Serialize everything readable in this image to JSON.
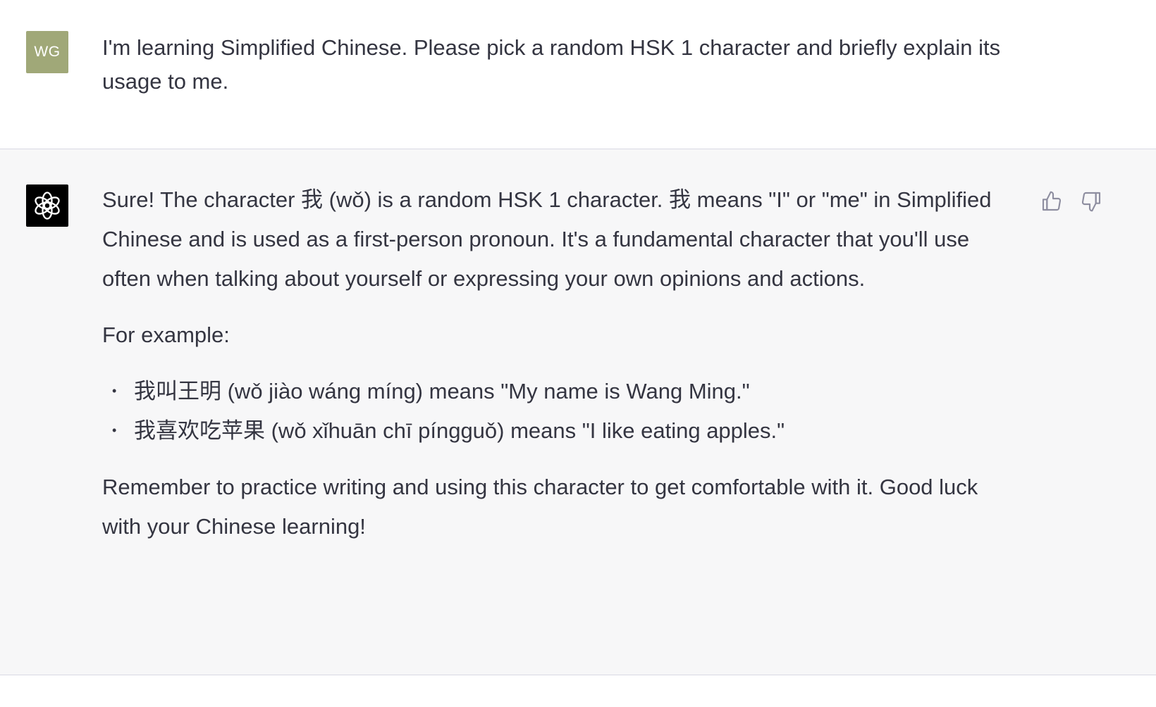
{
  "conversation": {
    "user": {
      "avatar_initials": "WG",
      "avatar_color": "#a0a878",
      "message": "I'm learning Simplified Chinese. Please pick a random HSK 1 character and briefly explain its usage to me."
    },
    "assistant": {
      "avatar_icon": "openai-logo-icon",
      "intro": "Sure! The character 我 (wǒ) is a random HSK 1 character. 我 means \"I\" or \"me\" in Simplified Chinese and is used as a first-person pronoun. It's a fundamental character that you'll use often when talking about yourself or expressing your own opinions and actions.",
      "example_heading": "For example:",
      "examples": [
        "我叫王明 (wǒ jiào wáng míng) means \"My name is Wang Ming.\"",
        "我喜欢吃苹果 (wǒ xǐhuān chī píngguǒ) means \"I like eating apples.\""
      ],
      "closing": "Remember to practice writing and using this character to get comfortable with it. Good luck with your Chinese learning!",
      "feedback": {
        "thumbs_up_icon": "thumbs-up-icon",
        "thumbs_down_icon": "thumbs-down-icon"
      }
    }
  },
  "colors": {
    "text": "#343541",
    "assistant_bg": "#f7f7f8",
    "divider": "#d9d9e3",
    "icon_gray": "#8e8ea0"
  }
}
